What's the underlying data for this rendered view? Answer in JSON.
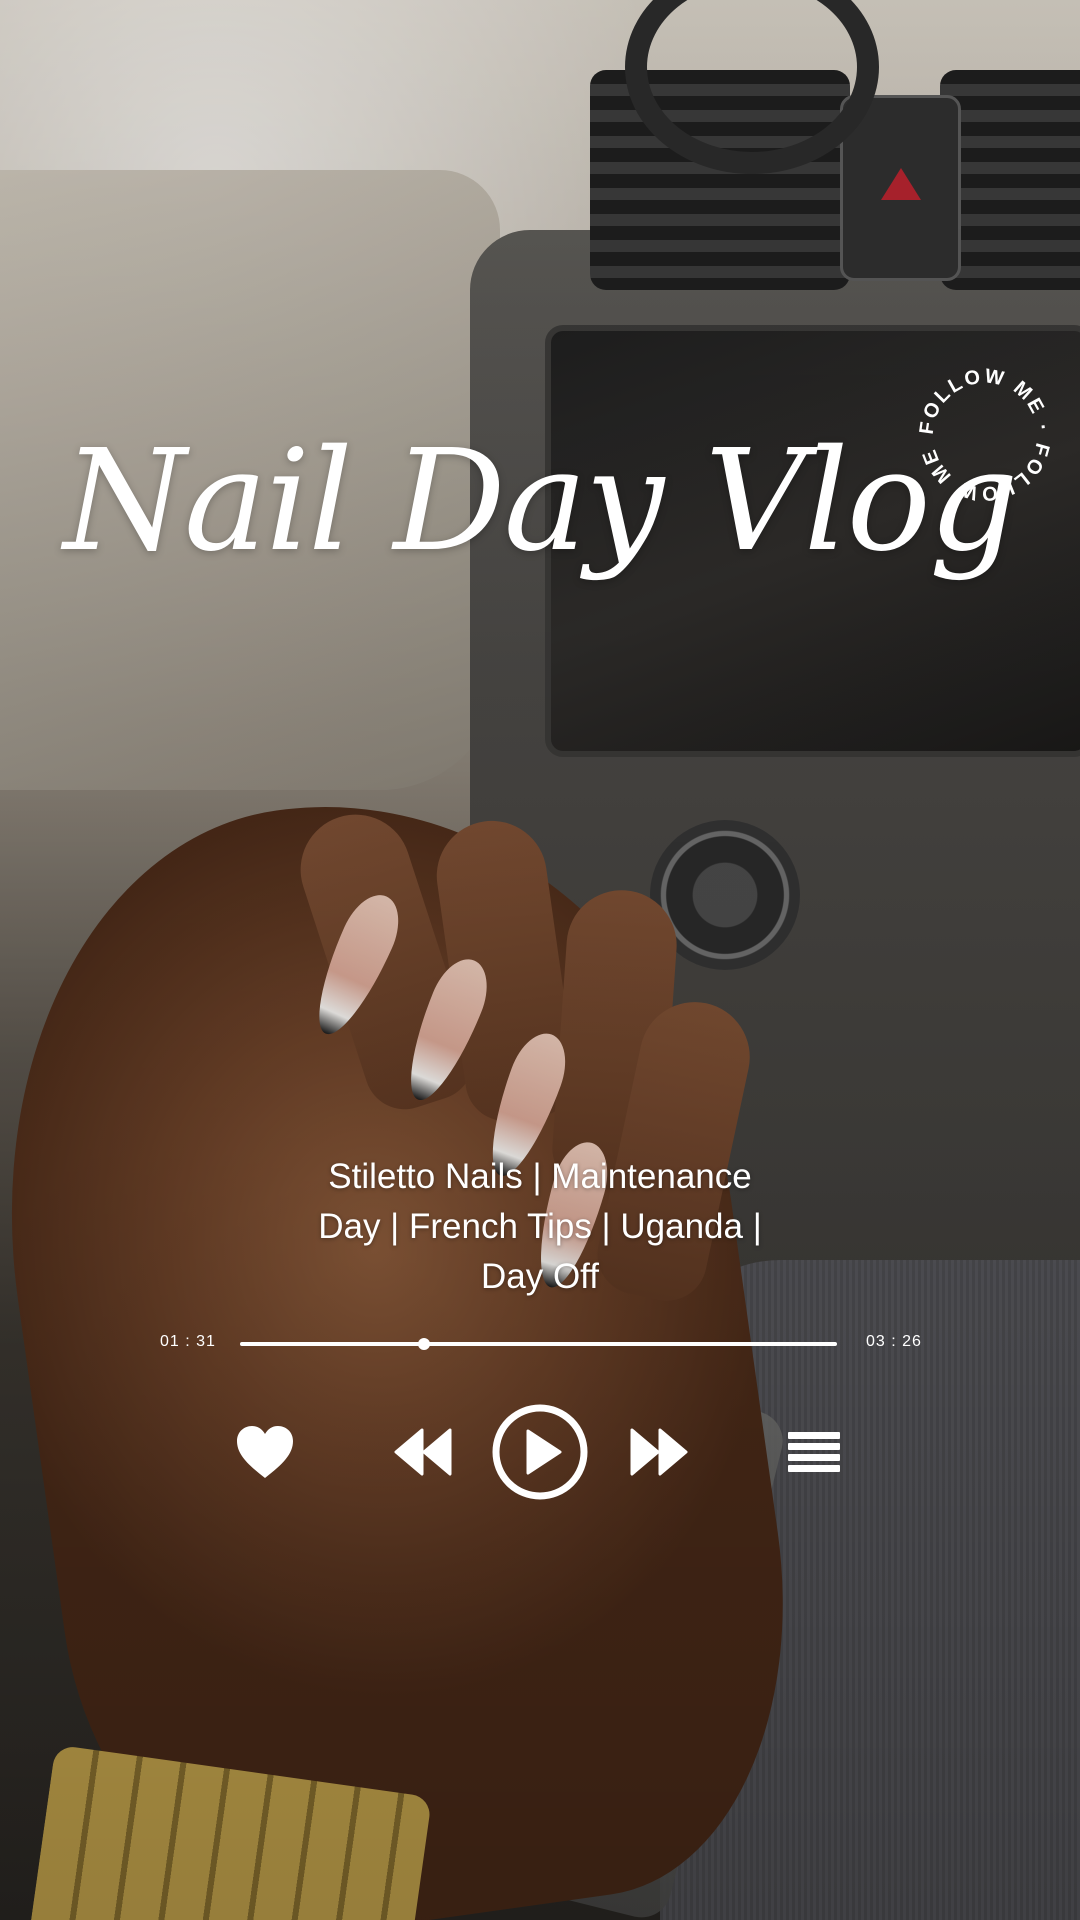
{
  "overlay": {
    "title": "Nail Day Vlog",
    "badge_text": "FOLLOW ME · FOLLOW ME · ",
    "subtitle_lines": [
      "Stiletto Nails | Maintenance",
      "Day | French Tips | Uganda |",
      "Day Off"
    ]
  },
  "player": {
    "elapsed": "01 : 31",
    "total": "03 : 26",
    "progress": 0.308,
    "controls": {
      "like_icon": "heart-icon",
      "rewind_icon": "rewind-icon",
      "play_icon": "play-icon",
      "forward_icon": "fast-forward-icon",
      "playlist_icon": "list-icon"
    },
    "accent_color": "#ffffff"
  }
}
